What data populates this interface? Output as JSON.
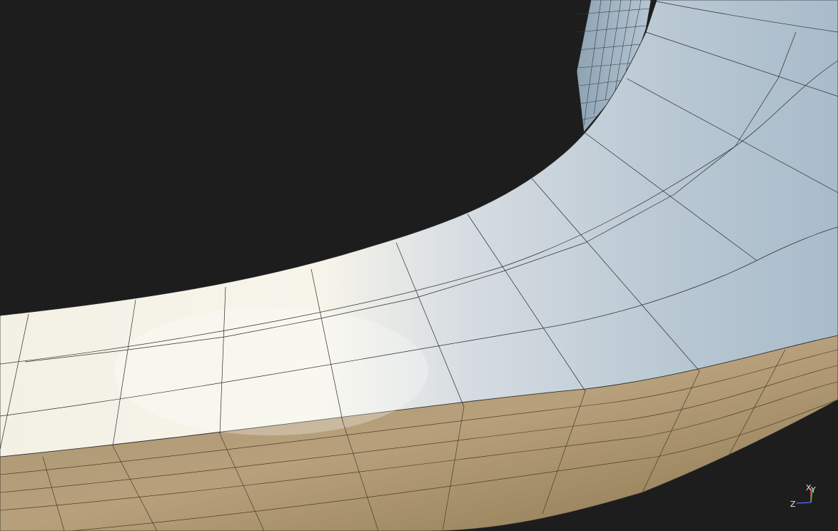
{
  "app": {
    "view": "3d-viewport",
    "background_color": "#1d1d1d",
    "wireframe_overlay": true
  },
  "scene": {
    "object": "curved-wall-mesh",
    "top_face_material": "light-grey-plaster",
    "side_face_material": "tan-wood",
    "colors": {
      "top_face_light": "#f4f2e8",
      "top_face_mid": "#cfd6dc",
      "top_face_shadow": "#9fb3c2",
      "side_face_light": "#b8a07a",
      "side_face_dark": "#6e5c3e",
      "wire": "#2a2a2a"
    }
  },
  "gizmo": {
    "x_label": "X",
    "y_label": "Y",
    "z_label": "Z",
    "x_color": "#d04040",
    "y_color": "#40c040",
    "z_color": "#5060e0"
  }
}
